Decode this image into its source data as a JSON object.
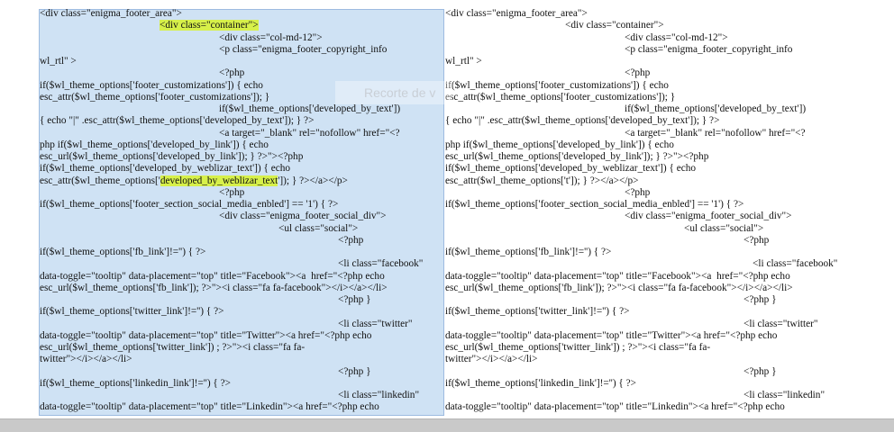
{
  "document": {
    "left_column": [
      {
        "indent": 0,
        "parts": [
          {
            "t": "<div class=\"enigma_footer_area\">"
          }
        ]
      },
      {
        "indent": 133,
        "parts": [
          {
            "t": "<div class=\"container\">",
            "hl": true
          }
        ]
      },
      {
        "indent": 199,
        "parts": [
          {
            "t": "<div class=\"col-md-12\">"
          }
        ]
      },
      {
        "indent": 199,
        "parts": [
          {
            "t": "<p class=\"enigma_footer_copyright_info"
          }
        ]
      },
      {
        "indent": 0,
        "parts": [
          {
            "t": "wl_rtl\" >"
          }
        ]
      },
      {
        "indent": 199,
        "parts": [
          {
            "t": "<?php"
          }
        ]
      },
      {
        "indent": 0,
        "parts": [
          {
            "t": "if($wl_theme_options['footer_customizations']) { echo"
          }
        ]
      },
      {
        "indent": 0,
        "parts": [
          {
            "t": "esc_attr($wl_theme_options['footer_customizations']); }"
          }
        ]
      },
      {
        "indent": 199,
        "parts": [
          {
            "t": "if($wl_theme_options['developed_by_text'])"
          }
        ]
      },
      {
        "indent": 0,
        "parts": [
          {
            "t": "{ echo \"|\" .esc_attr($wl_theme_options['developed_by_text']); } ?>"
          }
        ]
      },
      {
        "indent": 199,
        "parts": [
          {
            "t": "<a target=\"_blank\" rel=\"nofollow\" href=\"<?"
          }
        ]
      },
      {
        "indent": 0,
        "parts": [
          {
            "t": "php if($wl_theme_options['developed_by_link']) { echo"
          }
        ]
      },
      {
        "indent": 0,
        "parts": [
          {
            "t": "esc_url($wl_theme_options['developed_by_link']); } ?>\"><?php"
          }
        ]
      },
      {
        "indent": 0,
        "parts": [
          {
            "t": "if($wl_theme_options['developed_by_weblizar_text']) { echo"
          }
        ]
      },
      {
        "indent": 0,
        "parts": [
          {
            "t": "esc_attr($wl_theme_options['"
          },
          {
            "t": "developed_by_weblizar_text",
            "hl": true
          },
          {
            "t": "']); } ?></a></p>"
          }
        ]
      },
      {
        "indent": 199,
        "parts": [
          {
            "t": "<?php"
          }
        ]
      },
      {
        "indent": 0,
        "parts": [
          {
            "t": "if($wl_theme_options['footer_section_social_media_enbled'] == '1') { ?>"
          }
        ]
      },
      {
        "indent": 199,
        "parts": [
          {
            "t": "<div class=\"enigma_footer_social_div\">"
          }
        ]
      },
      {
        "indent": 265,
        "parts": [
          {
            "t": "<ul class=\"social\">"
          }
        ]
      },
      {
        "indent": 331,
        "parts": [
          {
            "t": "<?php"
          }
        ]
      },
      {
        "indent": 0,
        "parts": [
          {
            "t": "if($wl_theme_options['fb_link']!='') { ?>"
          }
        ]
      },
      {
        "indent": 331,
        "parts": [
          {
            "t": "<li class=\"facebook\""
          }
        ]
      },
      {
        "indent": 0,
        "parts": [
          {
            "t": "data-toggle=\"tooltip\" data-placement=\"top\" title=\"Facebook\"><a  href=\"<?php echo"
          }
        ]
      },
      {
        "indent": 0,
        "parts": [
          {
            "t": "esc_url($wl_theme_options['fb_link']); ?>\"><i class=\"fa fa-facebook\"></i></a></li>"
          }
        ]
      },
      {
        "indent": 331,
        "parts": [
          {
            "t": "<?php }"
          }
        ]
      },
      {
        "indent": 0,
        "parts": [
          {
            "t": "if($wl_theme_options['twitter_link']!='') { ?>"
          }
        ]
      },
      {
        "indent": 331,
        "parts": [
          {
            "t": "<li class=\"twitter\""
          }
        ]
      },
      {
        "indent": 0,
        "parts": [
          {
            "t": "data-toggle=\"tooltip\" data-placement=\"top\" title=\"Twitter\"><a href=\"<?php echo"
          }
        ]
      },
      {
        "indent": 0,
        "parts": [
          {
            "t": "esc_url($wl_theme_options['twitter_link']) ; ?>\"><i class=\"fa fa-"
          }
        ]
      },
      {
        "indent": 0,
        "parts": [
          {
            "t": "twitter\"></i></a></li>"
          }
        ]
      },
      {
        "indent": 331,
        "parts": [
          {
            "t": "<?php }"
          }
        ]
      },
      {
        "indent": 0,
        "parts": [
          {
            "t": "if($wl_theme_options['linkedin_link']!='') { ?>"
          }
        ]
      },
      {
        "indent": 331,
        "parts": [
          {
            "t": "<li class=\"linkedin\""
          }
        ]
      },
      {
        "indent": 0,
        "parts": [
          {
            "t": "data-toggle=\"tooltip\" data-placement=\"top\" title=\"Linkedin\"><a href=\"<?php echo"
          }
        ]
      }
    ],
    "right_column": [
      {
        "indent": 0,
        "parts": [
          {
            "t": "<div class=\"enigma_footer_area\">"
          }
        ]
      },
      {
        "indent": 133,
        "parts": [
          {
            "t": "<div class=\"container\">"
          }
        ]
      },
      {
        "indent": 199,
        "parts": [
          {
            "t": "<div class=\"col-md-12\">"
          }
        ]
      },
      {
        "indent": 199,
        "parts": [
          {
            "t": "<p class=\"enigma_footer_copyright_info"
          }
        ]
      },
      {
        "indent": 0,
        "parts": [
          {
            "t": "wl_rtl\" >"
          }
        ]
      },
      {
        "indent": 199,
        "parts": [
          {
            "t": "<?php"
          }
        ]
      },
      {
        "indent": 0,
        "parts": [
          {
            "t": "if($wl_theme_options['footer_customizations']) { echo"
          }
        ]
      },
      {
        "indent": 0,
        "parts": [
          {
            "t": "esc_attr($wl_theme_options['footer_customizations']); }"
          }
        ]
      },
      {
        "indent": 199,
        "parts": [
          {
            "t": "if($wl_theme_options['developed_by_text'])"
          }
        ]
      },
      {
        "indent": 0,
        "parts": [
          {
            "t": "{ echo \"|\" .esc_attr($wl_theme_options['developed_by_text']); } ?>"
          }
        ]
      },
      {
        "indent": 199,
        "parts": [
          {
            "t": "<a target=\"_blank\" rel=\"nofollow\" href=\"<?"
          }
        ]
      },
      {
        "indent": 0,
        "parts": [
          {
            "t": "php if($wl_theme_options['developed_by_link']) { echo"
          }
        ]
      },
      {
        "indent": 0,
        "parts": [
          {
            "t": "esc_url($wl_theme_options['developed_by_link']); } ?>\"><?php"
          }
        ]
      },
      {
        "indent": 0,
        "parts": [
          {
            "t": "if($wl_theme_options['developed_by_weblizar_text']) { echo"
          }
        ]
      },
      {
        "indent": 0,
        "parts": [
          {
            "t": "esc_attr($wl_theme_options['t']); } ?></a></p>"
          }
        ]
      },
      {
        "indent": 199,
        "parts": [
          {
            "t": "<?php"
          }
        ]
      },
      {
        "indent": 0,
        "parts": [
          {
            "t": "if($wl_theme_options['footer_section_social_media_enbled'] == '1') { ?>"
          }
        ]
      },
      {
        "indent": 199,
        "parts": [
          {
            "t": "<div class=\"enigma_footer_social_div\">"
          }
        ]
      },
      {
        "indent": 265,
        "parts": [
          {
            "t": "<ul class=\"social\">"
          }
        ]
      },
      {
        "indent": 331,
        "parts": [
          {
            "t": "<?php"
          }
        ]
      },
      {
        "indent": 0,
        "parts": [
          {
            "t": "if($wl_theme_options['fb_link']!='') { ?>"
          }
        ]
      },
      {
        "indent": 341,
        "parts": [
          {
            "t": "<li class=\"facebook\""
          }
        ]
      },
      {
        "indent": 0,
        "parts": [
          {
            "t": "data-toggle=\"tooltip\" data-placement=\"top\" title=\"Facebook\"><a  href=\"<?php echo"
          }
        ]
      },
      {
        "indent": 0,
        "parts": [
          {
            "t": "esc_url($wl_theme_options['fb_link']); ?>\"><i class=\"fa fa-facebook\"></i></a></li>"
          }
        ]
      },
      {
        "indent": 331,
        "parts": [
          {
            "t": "<?php }"
          }
        ]
      },
      {
        "indent": 0,
        "parts": [
          {
            "t": "if($wl_theme_options['twitter_link']!='') { ?>"
          }
        ]
      },
      {
        "indent": 331,
        "parts": [
          {
            "t": "<li class=\"twitter\""
          }
        ]
      },
      {
        "indent": 0,
        "parts": [
          {
            "t": "data-toggle=\"tooltip\" data-placement=\"top\" title=\"Twitter\"><a href=\"<?php echo"
          }
        ]
      },
      {
        "indent": 0,
        "parts": [
          {
            "t": "esc_url($wl_theme_options['twitter_link']) ; ?>\"><i class=\"fa fa-"
          }
        ]
      },
      {
        "indent": 0,
        "parts": [
          {
            "t": "twitter\"></i></a></li>"
          }
        ]
      },
      {
        "indent": 331,
        "parts": [
          {
            "t": "<?php }"
          }
        ]
      },
      {
        "indent": 0,
        "parts": [
          {
            "t": "if($wl_theme_options['linkedin_link']!='') { ?>"
          }
        ]
      },
      {
        "indent": 331,
        "parts": [
          {
            "t": "<li class=\"linkedin\""
          }
        ]
      },
      {
        "indent": 0,
        "parts": [
          {
            "t": "data-toggle=\"tooltip\" data-placement=\"top\" title=\"Linkedin\"><a href=\"<?php echo"
          }
        ]
      }
    ]
  },
  "overlay": {
    "ghost_text": "Recorte de v"
  },
  "colors": {
    "selection": "#cfe2f4",
    "highlight": "#d7f04a",
    "statusbar": "#c9c9c9"
  }
}
